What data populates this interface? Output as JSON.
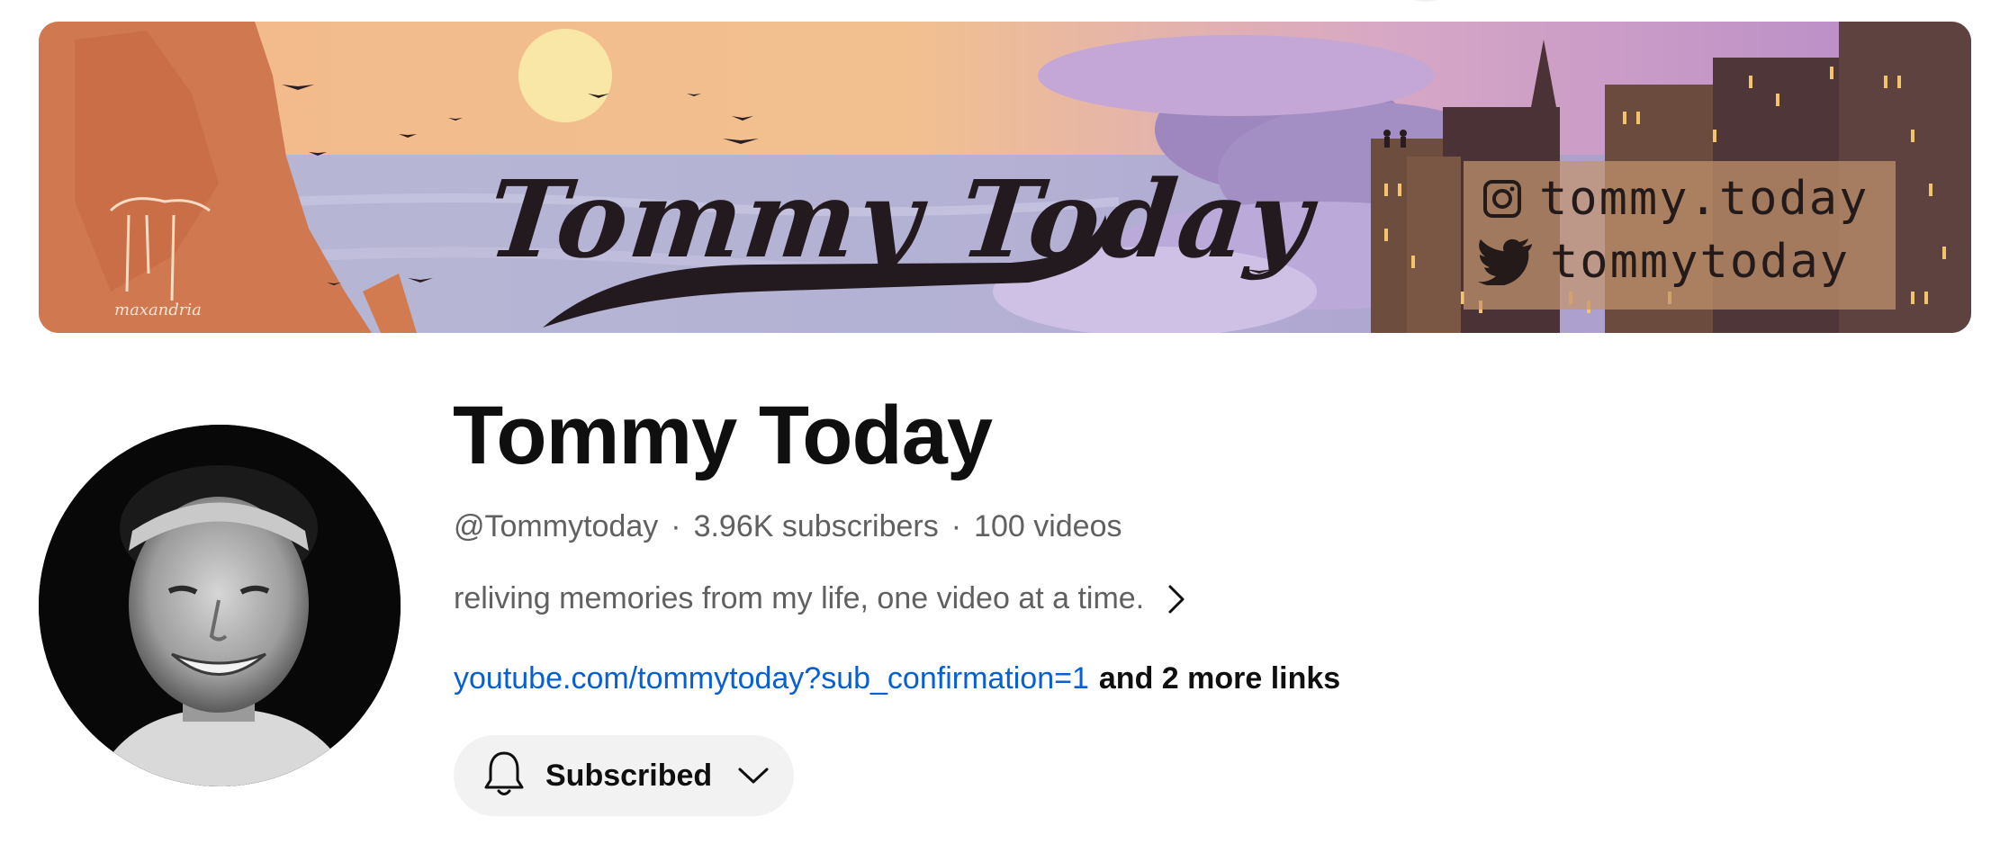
{
  "banner": {
    "title": "Tommy Today",
    "instagram_handle": "tommy.today",
    "twitter_handle": "tommytoday",
    "artist_signature": "maxandria"
  },
  "channel": {
    "name": "Tommy Today",
    "handle": "@Tommytoday",
    "separator": "·",
    "subscribers": "3.96K subscribers",
    "videos": "100 videos",
    "description": "reliving memories from my life, one video at a time.",
    "primary_link": "youtube.com/tommytoday?sub_confirmation=1",
    "more_links": "and 2 more links"
  },
  "subscribe_button": {
    "label": "Subscribed"
  },
  "icons": {
    "bell": "bell-icon",
    "chevron_right": "chevron-right-icon",
    "chevron_down": "chevron-down-icon",
    "instagram": "instagram-icon",
    "twitter": "twitter-icon"
  },
  "colors": {
    "link": "#065fd4",
    "secondary_text": "#606060",
    "button_bg": "#f2f2f2"
  }
}
